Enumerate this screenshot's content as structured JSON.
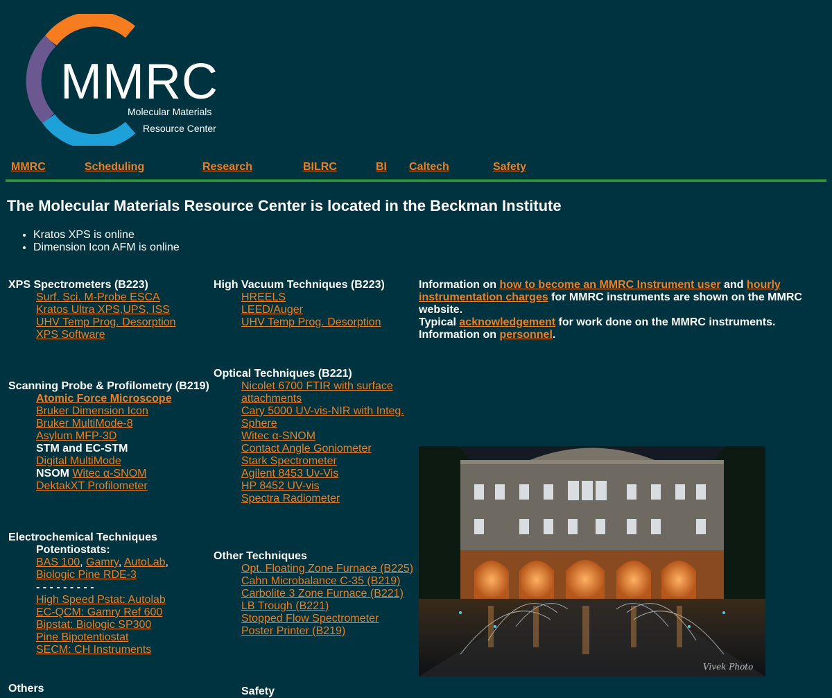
{
  "logo": {
    "title": "MMRC",
    "subtitle_line1": "Molecular Materials",
    "subtitle_line2": "Resource Center",
    "colors": {
      "orange": "#f57c1f",
      "purple": "#6b5890",
      "blue": "#1ea0d8"
    }
  },
  "nav": {
    "items": [
      "MMRC",
      "Scheduling",
      "Research",
      "BILRC",
      "BI",
      "Caltech",
      "Safety"
    ]
  },
  "page_title": "The Molecular Materials Resource Center is located in the Beckman Institute",
  "news": [
    "Kratos XPS is online",
    "Dimension Icon AFM is online"
  ],
  "sections": {
    "xps": {
      "title": "XPS Spectrometers (B223)",
      "items": [
        "Surf. Sci. M-Probe ESCA",
        "Kratos Ultra XPS,UPS, ISS",
        "UHV Temp Prog. Desorption",
        "XPS Software"
      ]
    },
    "spm": {
      "title": "Scanning Probe & Profilometry (B219)",
      "afm_label": "Atomic Force Microscope",
      "afm_items": [
        "Bruker Dimension Icon",
        "Bruker MultiMode-8",
        "Asylum MFP-3D"
      ],
      "stm_label": "STM and EC-STM",
      "stm_items": [
        "Digital MultiMode"
      ],
      "nsom_label": "NSOM",
      "nsom_link": "Witec α-SNOM",
      "dektak": "DektakXT Profilometer"
    },
    "electrochem": {
      "title": "Electrochemical Techniques",
      "potentiostats_label": "Potentiostats:",
      "pstat_links": [
        "BAS 100",
        "Gamry",
        "AutoLab"
      ],
      "pine": "Biologic Pine RDE-3",
      "separator": "- - - - - - - - -",
      "items": [
        "High Speed Pstat: Autolab",
        "EC-QCM: Gamry Ref 600",
        "Bipstat: Biologic SP300",
        "Pine Bipotentiostat",
        "SECM: CH Instruments"
      ]
    },
    "others": {
      "title": "Others"
    },
    "high_vacuum": {
      "title": "High Vacuum Techniques (B223)",
      "items": [
        "HREELS",
        "LEED/Auger",
        "UHV Temp Prog. Desorption"
      ]
    },
    "optical": {
      "title": "Optical Techniques (B221)",
      "items": [
        "Nicolet 6700 FTIR with surface",
        "attachments",
        "Cary 5000 UV-vis-NIR with Integ.",
        "Sphere",
        "Witec α-SNOM",
        "Contact Angle Goniometer",
        "Stark Spectrometer",
        "Agilent 8453 Uv-Vis",
        "HP 8452 UV-vis",
        "Spectra Radiometer"
      ]
    },
    "other_tech": {
      "title": "Other Techniques",
      "items": [
        "Opt. Floating Zone Furnace (B225)",
        "Cahn Microbalance C-35 (B219)",
        "Carbolite 3 Zone Furnace (B221)",
        "LB Trough (B221)",
        "Stopped Flow Spectrometer",
        "Poster Printer (B219)"
      ]
    },
    "safety": {
      "title": "Safety"
    }
  },
  "info": {
    "t1": "Information on ",
    "l1": "how to become an MMRC Instrument user",
    "t2": " and ",
    "l2a": "hourly",
    "l2b": "instrumentation charges",
    "t3": " for MMRC instruments are shown on the MMRC",
    "t4": "website.",
    "t5": "Typical ",
    "l3": "acknowledgement",
    "t6": " for work done on the MMRC instruments.",
    "t7": "Information on ",
    "l4": "personnel",
    "t8": "."
  },
  "photo": {
    "watermark": "Vivek Photo"
  }
}
